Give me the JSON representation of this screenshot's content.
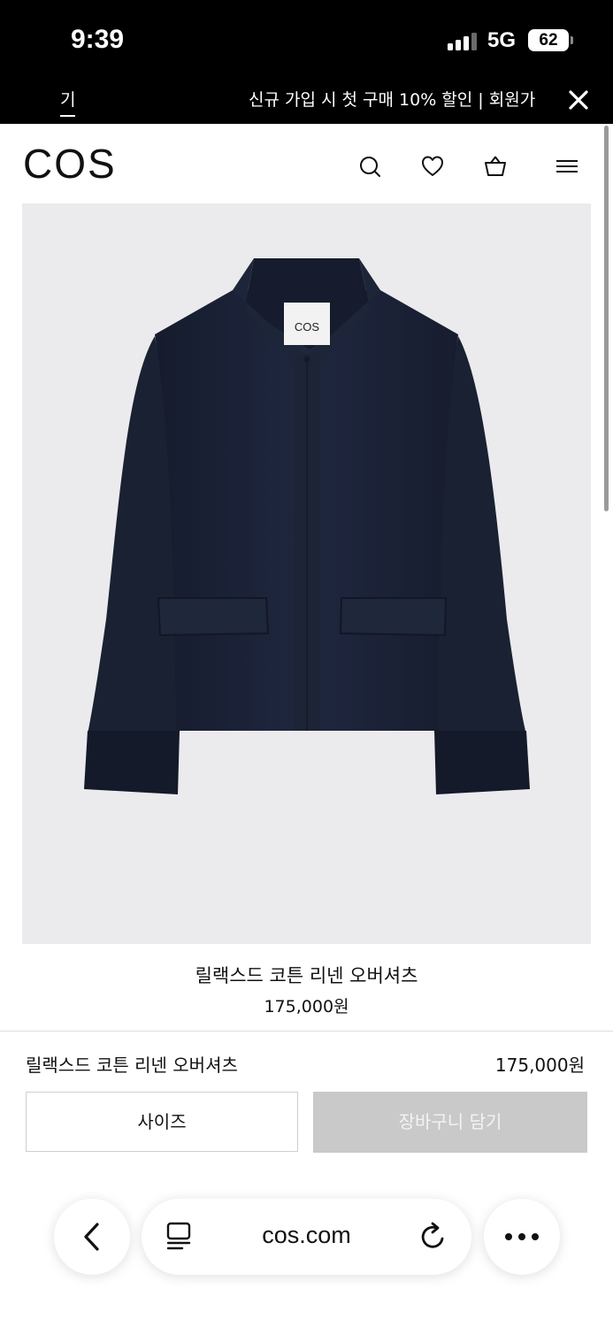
{
  "status_bar": {
    "time": "9:39",
    "network": "5G",
    "battery": "62"
  },
  "promo_banner": {
    "left_fragment": "기",
    "text": "신규 가입 시 첫 구매 10% 할인 | ",
    "link_text": "회원가"
  },
  "header": {
    "logo": "COS",
    "icons": [
      "search-icon",
      "heart-icon",
      "bag-icon",
      "menu-icon"
    ]
  },
  "product": {
    "image_label": "COS",
    "name": "릴랙스드 코튼 리넨 오버셔츠",
    "price": "175,000원"
  },
  "sticky_bar": {
    "name": "릴랙스드 코튼 리넨 오버셔츠",
    "price": "175,000원",
    "size_button": "사이즈",
    "add_to_cart_button": "장바구니 담기"
  },
  "browser": {
    "url": "cos.com"
  },
  "colors": {
    "accent_black": "#000000",
    "garment_navy": "#1b2235",
    "disabled_button": "#c9c9c9",
    "image_background": "#ebebed"
  }
}
